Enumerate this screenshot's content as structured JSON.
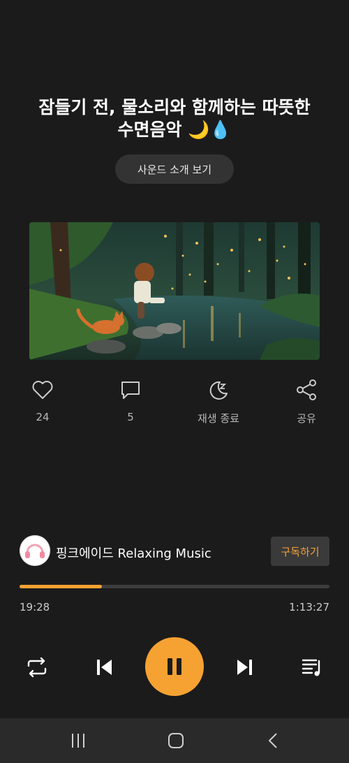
{
  "header": {
    "title_line1": "잠들기 전, 물소리와 함께하는 따뜻한",
    "title_line2": "수면음악 🌙💧",
    "intro_button": "사운드 소개 보기"
  },
  "actions": [
    {
      "icon": "heart-icon",
      "label": "24"
    },
    {
      "icon": "comment-icon",
      "label": "5"
    },
    {
      "icon": "sleep-timer-icon",
      "label": "재생 종료"
    },
    {
      "icon": "share-icon",
      "label": "공유"
    }
  ],
  "channel": {
    "name": "핑크에이드 Relaxing Music",
    "subscribe_label": "구독하기"
  },
  "player": {
    "current_time": "19:28",
    "total_time": "1:13:27",
    "progress": 0.265,
    "accent_color": "#f6a233"
  },
  "controls": [
    "repeat-icon",
    "previous-icon",
    "pause-icon",
    "next-icon",
    "playlist-icon"
  ],
  "system_nav": [
    "recent-apps-icon",
    "home-icon",
    "back-icon"
  ]
}
